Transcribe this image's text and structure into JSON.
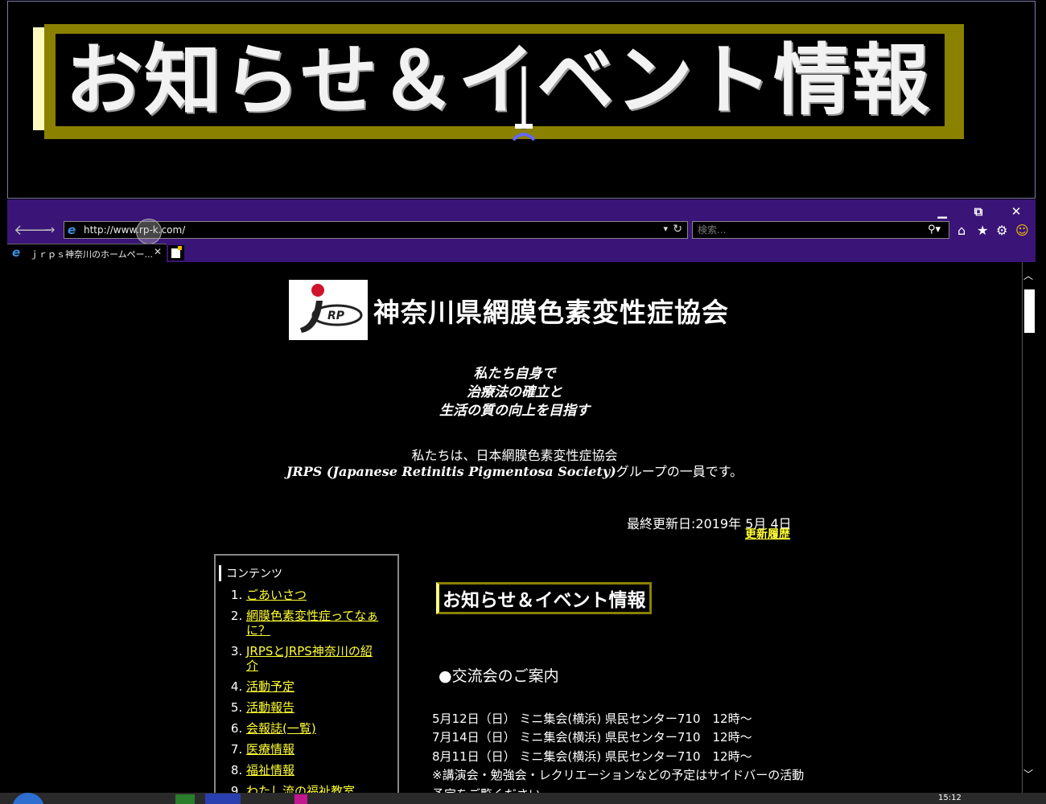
{
  "magnifier": {
    "heading": "お知らせ＆イベント情報"
  },
  "browser": {
    "url": "http://www.rp-k.com/",
    "search_placeholder": "検索...",
    "tab_title": "ｊｒｐｓ神奈川のホームペー...",
    "window_buttons": {
      "minimize": "▁",
      "restore": "⧉",
      "close": "✕"
    }
  },
  "page": {
    "site_title": "神奈川県網膜色素変性症協会",
    "logo_text": "RP",
    "slogan": [
      "私たち自身で",
      "治療法の確立と",
      "生活の質の向上を目指す"
    ],
    "intro_line1": "私たちは、日本網膜色素変性症協会",
    "intro_line2_en": "JRPS (Japanese Retinitis Pigmentosa Society)",
    "intro_line2_jp": "グループの一員です。",
    "last_updated": "最終更新日:2019年 5月 4日",
    "history_link": "更新履歴",
    "contents": {
      "heading": "コンテンツ",
      "items": [
        "ごあいさつ",
        "網膜色素変性症ってなぁに？",
        "JRPSとJRPS神奈川の紹介",
        "活動予定",
        "活動報告",
        "会報誌(一覧)",
        "医療情報",
        "福祉情報",
        "わたし流の福祉教室"
      ]
    },
    "events": {
      "heading": "お知らせ＆イベント情報",
      "meeting_heading": "●交流会のご案内",
      "lines": [
        "5月12日（日） ミニ集会(横浜) 県民センター710　12時～",
        "7月14日（日） ミニ集会(横浜) 県民センター710　12時～",
        "8月11日（日） ミニ集会(横浜) 県民センター710　12時～",
        "※講演会・勉強会・レクリエーションなどの予定はサイドバーの活動",
        "予定をご覧ください。"
      ]
    }
  },
  "taskbar": {
    "clock": "15:12"
  }
}
